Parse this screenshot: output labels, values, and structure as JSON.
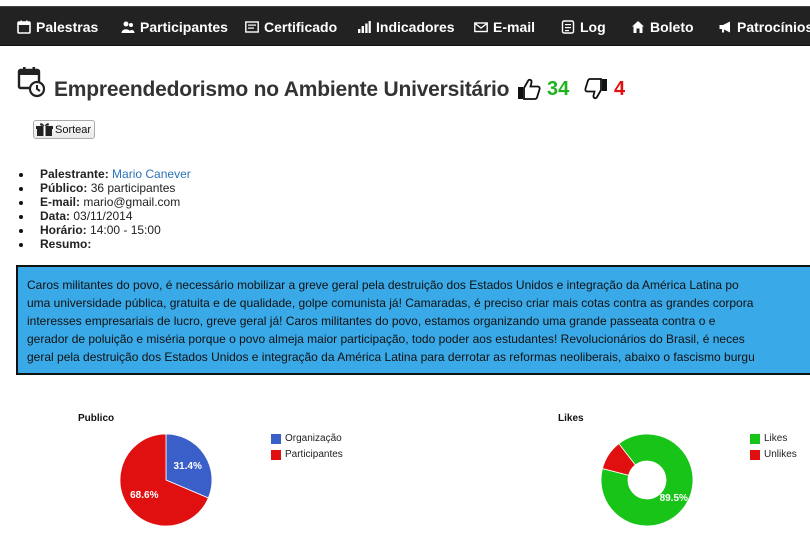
{
  "nav": [
    {
      "label": "Palestras",
      "icon": "calendar-icon"
    },
    {
      "label": "Participantes",
      "icon": "users-icon"
    },
    {
      "label": "Certificado",
      "icon": "certificate-icon"
    },
    {
      "label": "Indicadores",
      "icon": "bar-chart-icon"
    },
    {
      "label": "E-mail",
      "icon": "envelope-icon"
    },
    {
      "label": "Log",
      "icon": "log-icon"
    },
    {
      "label": "Boleto",
      "icon": "home-icon"
    },
    {
      "label": "Patrocínios",
      "icon": "megaphone-icon"
    }
  ],
  "talk": {
    "title": "Empreendedorismo no Ambiente Universitário",
    "likes": "34",
    "dislikes": "4",
    "draw_button": "Sortear"
  },
  "details": {
    "speaker_label": "Palestrante:",
    "speaker": "Mario Canever",
    "audience_label": "Público:",
    "audience": "36 participantes",
    "email_label": "E-mail:",
    "email": "mario@gmail.com",
    "date_label": "Data:",
    "date": "03/11/2014",
    "time_label": "Horário:",
    "time": "14:00 - 15:00",
    "summary_label": "Resumo:"
  },
  "summary_lines": [
    "Caros militantes do povo, é necessário mobilizar a greve geral pela destruição dos Estados Unidos e integração da América Latina po",
    "uma universidade pública, gratuita e de qualidade, golpe comunista já! Camaradas, é preciso criar mais cotas contra as grandes corpora",
    "interesses empresariais de lucro, greve geral já! Caros militantes do povo, estamos organizando uma grande passeata contra o e",
    "gerador de poluição e miséria porque o povo almeja maior participação, todo poder aos estudantes! Revolucionários do Brasil, é neces",
    "geral pela destruição dos Estados Unidos e integração da América Latina para derrotar as reformas neoliberais, abaixo o fascismo burgu"
  ],
  "colors": {
    "navbar": "#222222",
    "summary_bg": "#39a9e8",
    "likes": "#1db31d",
    "dislikes": "#e01010",
    "link": "#2a74b8"
  },
  "chart_data": [
    {
      "type": "pie",
      "title": "Publico",
      "categories": [
        "Organização",
        "Participantes"
      ],
      "values": [
        31.4,
        68.6
      ],
      "labels": [
        "31.4%",
        "68.6%"
      ],
      "colors": [
        "#3b5fc9",
        "#e01010"
      ],
      "legend": "right"
    },
    {
      "type": "pie",
      "title": "Likes",
      "donut": true,
      "categories": [
        "Likes",
        "Unlikes"
      ],
      "values": [
        89.5,
        10.5
      ],
      "labels": [
        "89.5%",
        ""
      ],
      "colors": [
        "#17c417",
        "#e01010"
      ],
      "legend": "right"
    }
  ]
}
